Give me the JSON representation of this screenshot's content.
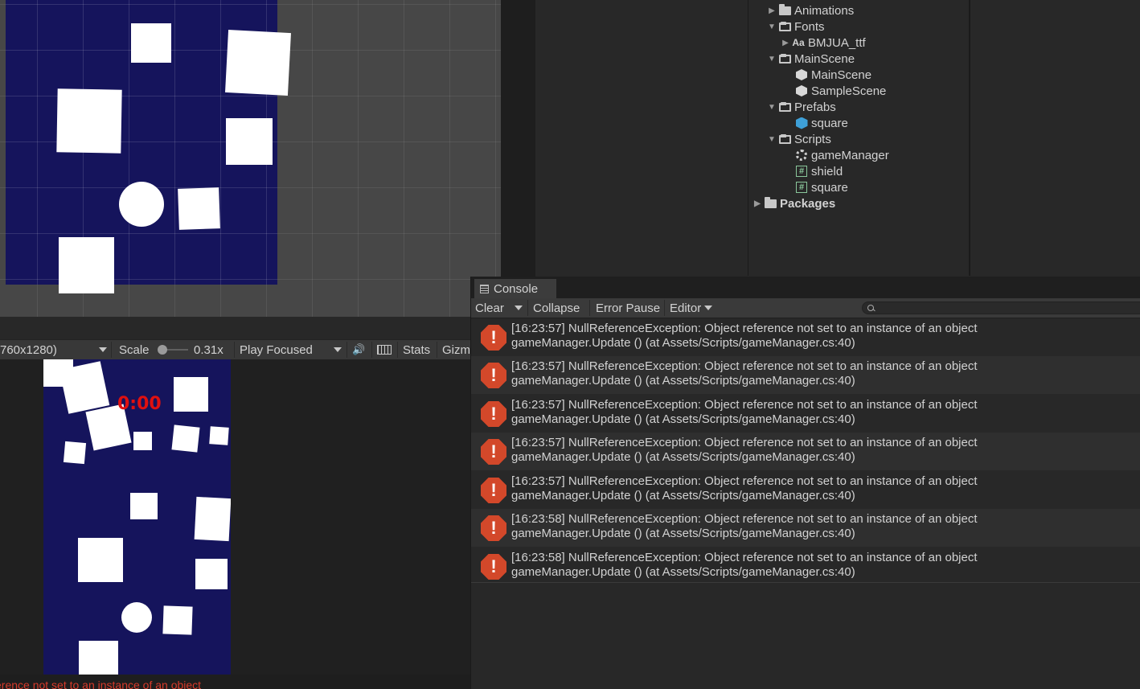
{
  "project": {
    "tree": [
      {
        "label": "Animations",
        "icon": "folder-icon",
        "expanded": false
      },
      {
        "label": "Fonts",
        "icon": "folder-open-icon",
        "expanded": true
      },
      {
        "label": "BMJUA_ttf",
        "icon": "font-icon"
      },
      {
        "label": "MainScene",
        "icon": "folder-open-icon",
        "expanded": true
      },
      {
        "label": "MainScene",
        "icon": "unity-scene-icon"
      },
      {
        "label": "SampleScene",
        "icon": "unity-scene-icon"
      },
      {
        "label": "Prefabs",
        "icon": "folder-open-icon",
        "expanded": true
      },
      {
        "label": "square",
        "icon": "prefab-cube-icon"
      },
      {
        "label": "Scripts",
        "icon": "folder-open-icon",
        "expanded": true
      },
      {
        "label": "gameManager",
        "icon": "gear-script-icon"
      },
      {
        "label": "shield",
        "icon": "csharp-script-icon"
      },
      {
        "label": "square",
        "icon": "csharp-script-icon"
      },
      {
        "label": "Packages",
        "icon": "folder-icon",
        "expanded": false
      }
    ],
    "font_icon_text": "Aa"
  },
  "game_toolbar": {
    "resolution": "760x1280)",
    "scale_label": "Scale",
    "scale_value": "0.31x",
    "play_mode": "Play Focused",
    "stats": "Stats",
    "gizmos": "Gizm"
  },
  "game": {
    "timer": "0:00"
  },
  "status_bar": {
    "message": "erence not set to an instance of an object"
  },
  "console": {
    "tab_label": "Console",
    "toolbar": {
      "clear": "Clear",
      "collapse": "Collapse",
      "error_pause": "Error Pause",
      "editor": "Editor"
    },
    "search_placeholder": "",
    "entries": [
      {
        "line1": "[16:23:57] NullReferenceException: Object reference not set to an instance of an object",
        "line2": "gameManager.Update () (at Assets/Scripts/gameManager.cs:40)"
      },
      {
        "line1": "[16:23:57] NullReferenceException: Object reference not set to an instance of an object",
        "line2": "gameManager.Update () (at Assets/Scripts/gameManager.cs:40)"
      },
      {
        "line1": "[16:23:57] NullReferenceException: Object reference not set to an instance of an object",
        "line2": "gameManager.Update () (at Assets/Scripts/gameManager.cs:40)"
      },
      {
        "line1": "[16:23:57] NullReferenceException: Object reference not set to an instance of an object",
        "line2": "gameManager.Update () (at Assets/Scripts/gameManager.cs:40)"
      },
      {
        "line1": "[16:23:57] NullReferenceException: Object reference not set to an instance of an object",
        "line2": "gameManager.Update () (at Assets/Scripts/gameManager.cs:40)"
      },
      {
        "line1": "[16:23:58] NullReferenceException: Object reference not set to an instance of an object",
        "line2": "gameManager.Update () (at Assets/Scripts/gameManager.cs:40)"
      },
      {
        "line1": "[16:23:58] NullReferenceException: Object reference not set to an instance of an object",
        "line2": "gameManager.Update () (at Assets/Scripts/gameManager.cs:40)"
      }
    ]
  },
  "colors": {
    "board_blue": "#15145c",
    "error_red": "#d3482a",
    "timer_red": "#e01010"
  }
}
